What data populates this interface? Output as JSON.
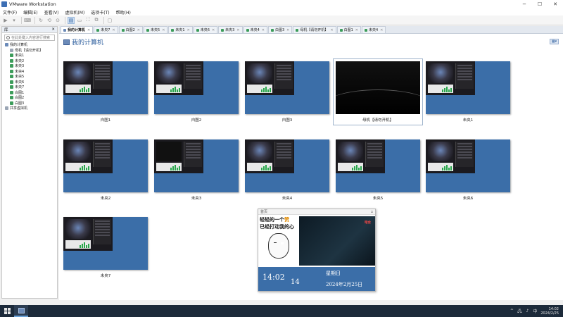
{
  "window": {
    "title": "VMware Workstation"
  },
  "menu": [
    "文件(F)",
    "编辑(E)",
    "查看(V)",
    "虚拟机(M)",
    "选项卡(T)",
    "帮助(H)"
  ],
  "library": {
    "header": "库",
    "search_placeholder": "在此处键入内容进行搜索",
    "tree": [
      {
        "label": "我的计算机",
        "type": "pc",
        "indent": 0
      },
      {
        "label": "母机【请勿开机】",
        "type": "off",
        "indent": 1
      },
      {
        "label": "未央1",
        "type": "vm",
        "indent": 1
      },
      {
        "label": "未央2",
        "type": "vm",
        "indent": 1
      },
      {
        "label": "未央3",
        "type": "vm",
        "indent": 1
      },
      {
        "label": "未央4",
        "type": "vm",
        "indent": 1
      },
      {
        "label": "未央5",
        "type": "vm",
        "indent": 1
      },
      {
        "label": "未央6",
        "type": "vm",
        "indent": 1
      },
      {
        "label": "未央7",
        "type": "vm",
        "indent": 1
      },
      {
        "label": "白图1",
        "type": "vm",
        "indent": 1
      },
      {
        "label": "白图2",
        "type": "vm",
        "indent": 1
      },
      {
        "label": "白图3",
        "type": "vm",
        "indent": 1
      },
      {
        "label": "共享虚拟机",
        "type": "off",
        "indent": 0
      }
    ]
  },
  "tabs": [
    {
      "label": "我的计算机",
      "active": true,
      "home": true
    },
    {
      "label": "未央7"
    },
    {
      "label": "白图2"
    },
    {
      "label": "未央5"
    },
    {
      "label": "未央1"
    },
    {
      "label": "未央6"
    },
    {
      "label": "未央3"
    },
    {
      "label": "未央4"
    },
    {
      "label": "白图3"
    },
    {
      "label": "母机【请勿开机】"
    },
    {
      "label": "白图1"
    },
    {
      "label": "未央4"
    }
  ],
  "main": {
    "title": "我的计算机",
    "thumbs": [
      {
        "label": "白图1",
        "kind": "game"
      },
      {
        "label": "白图2",
        "kind": "game"
      },
      {
        "label": "白图3",
        "kind": "game"
      },
      {
        "label": "母机【请勿开机】",
        "kind": "black",
        "selected": true
      },
      {
        "label": "未央1",
        "kind": "game"
      },
      {
        "label": "未央2",
        "kind": "game"
      },
      {
        "label": "未央3",
        "kind": "dark"
      },
      {
        "label": "未央4",
        "kind": "game"
      },
      {
        "label": "未央5",
        "kind": "game"
      },
      {
        "label": "未央6",
        "kind": "game"
      },
      {
        "label": "未央7",
        "kind": "game"
      }
    ]
  },
  "popup": {
    "header": "首页",
    "meme_line1a": "轻轻的一个",
    "meme_line1b": "赞",
    "meme_line2": "已经打动我的心",
    "space_tag": "暗金",
    "time": "14:02",
    "day": "14",
    "weekday": "星期日",
    "date": "2024年2月25日"
  },
  "taskbar": {
    "time": "14:02",
    "date": "2024/2/25"
  }
}
